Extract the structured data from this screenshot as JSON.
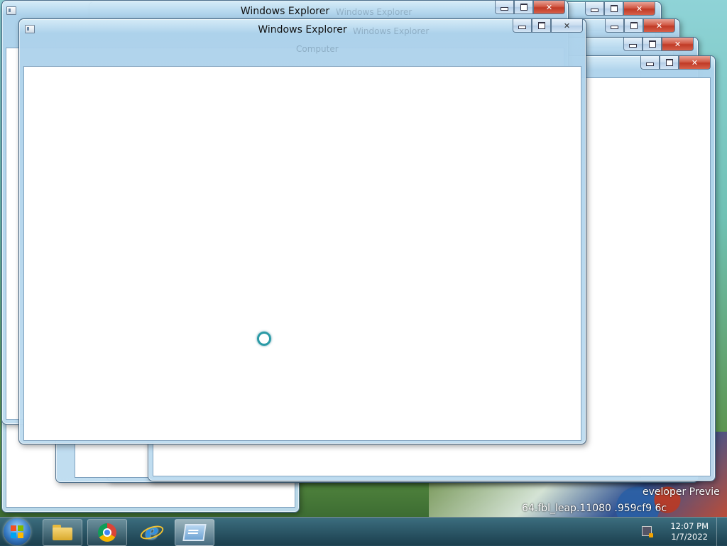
{
  "windows": {
    "front_title": "Windows Explorer",
    "back1_title": "Windows Explorer",
    "ghost_title_1": "Windows Explorer",
    "ghost_title_2": "Computer",
    "ghost_title_3": "Windows Explorer",
    "minimize_glyph": "",
    "maximize_glyph": "",
    "close_glyph": "✕"
  },
  "desktop": {
    "watermark_line1": "eveloper Previe",
    "watermark_line2": "64.fbl_leap.11080 .959cf9 6c"
  },
  "taskbar": {
    "apps": [
      "Windows Explorer",
      "Google Chrome",
      "Internet Explorer",
      "Windows Explorer (active)"
    ],
    "clock_time": "12:07 PM",
    "clock_date": "1/7/2022"
  },
  "colors": {
    "close_button": "#c94a36",
    "spinner": "#2a9aa6",
    "taskbar": "#1f4a62"
  }
}
